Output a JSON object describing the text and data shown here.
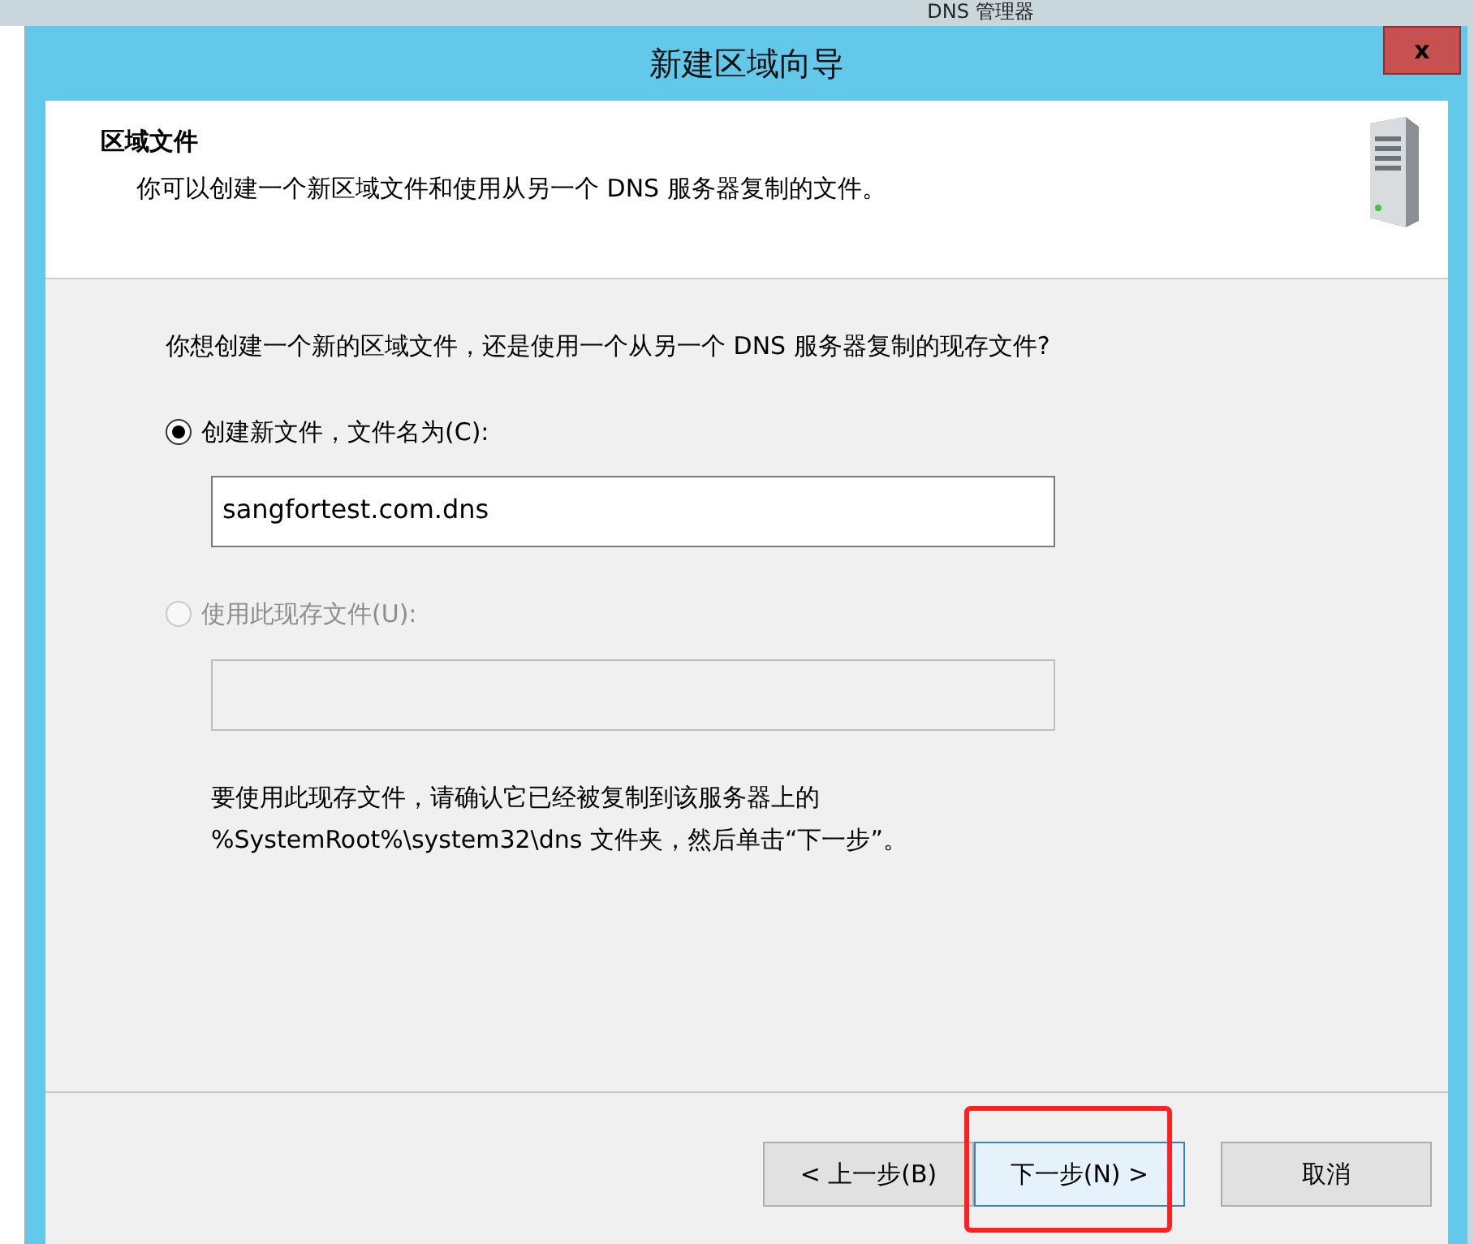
{
  "background_window": {
    "title": "DNS 管理器"
  },
  "dialog": {
    "title": "新建区域向导",
    "close": "x"
  },
  "header": {
    "title": "区域文件",
    "description": "你可以创建一个新区域文件和使用从另一个 DNS 服务器复制的文件。"
  },
  "question": "你想创建一个新的区域文件，还是使用一个从另一个 DNS 服务器复制的现存文件?",
  "options": [
    {
      "label": "创建新文件，文件名为(C):",
      "selected": true,
      "disabled": false,
      "value": "sangfortest.com.dns"
    },
    {
      "label": "使用此现存文件(U):",
      "selected": false,
      "disabled": true
    }
  ],
  "note": "要使用此现存文件，请确认它已经被复制到该服务器上的\n%SystemRoot%\\system32\\dns 文件夹，然后单击“下一步”。",
  "buttons": [
    {
      "label": "< 上一步(B)",
      "focused": false,
      "highlighted": false
    },
    {
      "label": "下一步(N) >",
      "focused": true,
      "highlighted": true
    },
    {
      "label": "取消",
      "focused": false,
      "highlighted": false
    }
  ]
}
